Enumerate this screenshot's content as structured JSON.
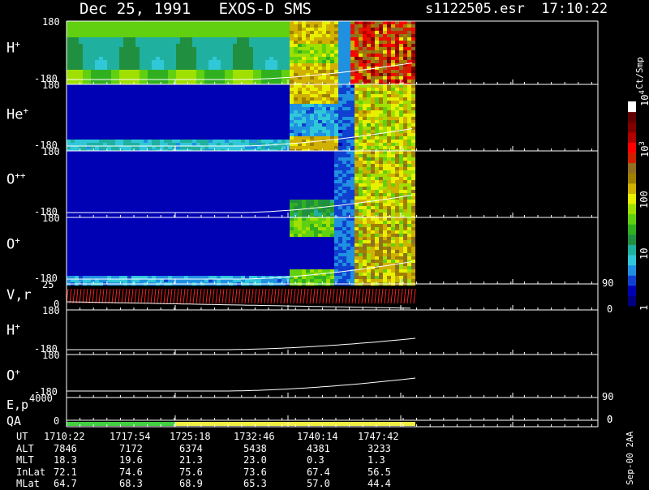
{
  "header": {
    "title": "Dec 25, 1991   EXOS-D SMS",
    "file_info": "s1122505.esr  17:10:22"
  },
  "panels": [
    {
      "label_main": "H",
      "label_sup": "+",
      "top_tick": "180",
      "bottom_tick": "-180"
    },
    {
      "label_main": "He",
      "label_sup": "+",
      "top_tick": "180",
      "bottom_tick": "-180"
    },
    {
      "label_main": "O",
      "label_sup": "++",
      "top_tick": "180",
      "bottom_tick": "-180"
    },
    {
      "label_main": "O",
      "label_sup": "+",
      "top_tick": "180",
      "bottom_tick": "-180"
    },
    {
      "label_main": "V,r",
      "label_sup": "",
      "top_tick": "25",
      "bottom_tick": "0",
      "right_top": "90",
      "right_bottom": "0"
    },
    {
      "label_main": "H",
      "label_sup": "+",
      "top_tick": "180",
      "bottom_tick": "-180"
    },
    {
      "label_main": "O",
      "label_sup": "+",
      "top_tick": "180",
      "bottom_tick": "-180"
    },
    {
      "label_main": "E,p",
      "label_sup": "",
      "top_tick": "4000",
      "bottom_tick": "",
      "right_top": "90",
      "right_bottom": "0"
    },
    {
      "label_main": "QA",
      "label_sup": "",
      "top_tick": "",
      "bottom_tick": "0"
    }
  ],
  "colorbar": {
    "unit": "Ct/Smp",
    "labels": [
      {
        "text": "1",
        "level": 0
      },
      {
        "text": "10",
        "level": 0.25
      },
      {
        "text": "100",
        "level": 0.5
      },
      {
        "text": "10",
        "sup": "3",
        "level": 0.75
      },
      {
        "text": "10",
        "sup": "4",
        "level": 1.0
      }
    ],
    "colors": [
      "#000080",
      "#0000b4",
      "#1040d0",
      "#2090e0",
      "#30c8d8",
      "#20b0a0",
      "#209040",
      "#30b020",
      "#60d010",
      "#a0e000",
      "#e8f000",
      "#d0b000",
      "#a08000",
      "#907020",
      "#d02000",
      "#ff0000",
      "#b00000",
      "#800000",
      "#600000",
      "#ffffff"
    ]
  },
  "footer": {
    "stamp": "Sep-00 2AA",
    "rows": [
      {
        "label": "UT",
        "values": [
          "1710:22",
          "1717:54",
          "1725:18",
          "1732:46",
          "1740:14",
          "1747:42"
        ]
      },
      {
        "label": "ALT",
        "values": [
          "7846",
          "7172",
          "6374",
          "5438",
          "4381",
          "3233"
        ]
      },
      {
        "label": "MLT",
        "values": [
          "18.3",
          "19.6",
          "21.3",
          "23.0",
          "0.3",
          "1.3"
        ]
      },
      {
        "label": "InLat",
        "values": [
          "72.1",
          "74.6",
          "75.6",
          "73.6",
          "67.4",
          "56.5"
        ]
      },
      {
        "label": "MLat",
        "values": [
          "64.7",
          "68.3",
          "68.9",
          "65.3",
          "57.0",
          "44.4"
        ]
      }
    ]
  },
  "chart_data": {
    "type": "heatmap",
    "title": "Dec 25, 1991   EXOS-D SMS",
    "x": [
      "1710:22",
      "1717:54",
      "1725:18",
      "1732:46",
      "1740:14",
      "1747:42"
    ],
    "spectrograms": [
      {
        "name": "H+",
        "ylim": [
          -180,
          180
        ]
      },
      {
        "name": "He+",
        "ylim": [
          -180,
          180
        ]
      },
      {
        "name": "O++",
        "ylim": [
          -180,
          180
        ]
      },
      {
        "name": "O+",
        "ylim": [
          -180,
          180
        ]
      }
    ],
    "line_panels": [
      {
        "name": "V,r",
        "ylim": [
          0,
          25
        ],
        "right_ylim": [
          0,
          90
        ]
      },
      {
        "name": "H+",
        "ylim": [
          -180,
          180
        ]
      },
      {
        "name": "O+",
        "ylim": [
          -180,
          180
        ]
      },
      {
        "name": "E,p",
        "ylim": [
          0,
          4000
        ],
        "right_ylim": [
          0,
          90
        ]
      }
    ],
    "qa_segments": [
      {
        "from": "1710:22",
        "to": "1725:18",
        "color": "#40d040"
      },
      {
        "from": "1725:18",
        "to": "1750:30",
        "color": "#f0f040"
      }
    ],
    "colorbar_range": [
      1,
      10000
    ],
    "colorbar_scale": "log",
    "colorbar_unit": "Ct/Smp"
  }
}
